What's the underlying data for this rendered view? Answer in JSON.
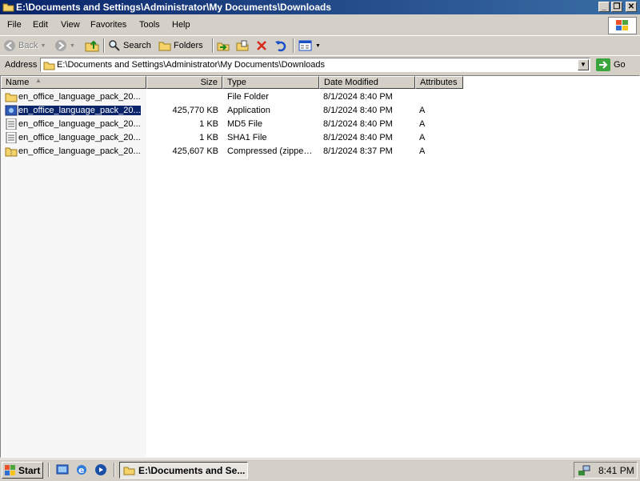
{
  "window": {
    "title": "E:\\Documents and Settings\\Administrator\\My Documents\\Downloads",
    "minimize_glyph": "_",
    "restore_glyph": "❐",
    "close_glyph": "✕"
  },
  "menu": [
    "File",
    "Edit",
    "View",
    "Favorites",
    "Tools",
    "Help"
  ],
  "toolbar": {
    "back_label": "Back",
    "search_label": "Search",
    "folders_label": "Folders"
  },
  "address": {
    "label": "Address",
    "value": "E:\\Documents and Settings\\Administrator\\My Documents\\Downloads",
    "go_label": "Go"
  },
  "columns": [
    "Name",
    "Size",
    "Type",
    "Date Modified",
    "Attributes"
  ],
  "files": [
    {
      "name": "en_office_language_pack_20...",
      "size": "",
      "type": "File Folder",
      "date": "8/1/2024 8:40 PM",
      "attr": "",
      "icon": "folder-icon"
    },
    {
      "name": "en_office_language_pack_20...",
      "size": "425,770 KB",
      "type": "Application",
      "date": "8/1/2024 8:40 PM",
      "attr": "A",
      "icon": "application-icon"
    },
    {
      "name": "en_office_language_pack_20...",
      "size": "1 KB",
      "type": "MD5 File",
      "date": "8/1/2024 8:40 PM",
      "attr": "A",
      "icon": "document-icon"
    },
    {
      "name": "en_office_language_pack_20...",
      "size": "1 KB",
      "type": "SHA1 File",
      "date": "8/1/2024 8:40 PM",
      "attr": "A",
      "icon": "document-icon"
    },
    {
      "name": "en_office_language_pack_20...",
      "size": "425,607 KB",
      "type": "Compressed (zipped Folder)",
      "date": "8/1/2024 8:37 PM",
      "attr": "A",
      "icon": "zip-folder-icon"
    }
  ],
  "selected_row": 1,
  "taskbar": {
    "start_label": "Start",
    "task_label": "E:\\Documents and Se...",
    "clock": "8:41 PM"
  },
  "colors": {
    "title_active": "#0a246a",
    "face": "#d4d0c8",
    "selection": "#0a246a"
  }
}
